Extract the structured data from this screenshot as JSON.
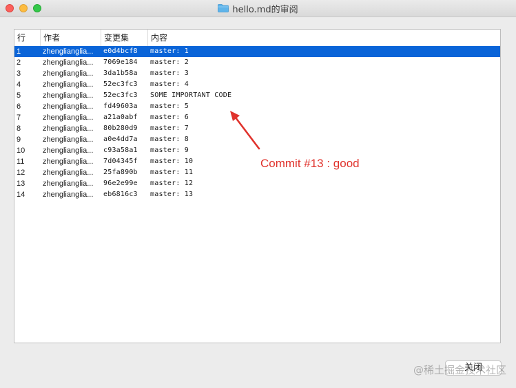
{
  "window": {
    "title": "hello.md的审阅"
  },
  "table": {
    "headers": {
      "line": "行",
      "author": "作者",
      "changeset": "变更集",
      "content": "内容"
    },
    "rows": [
      {
        "line": "1",
        "author": "zhenglianglia...",
        "changeset": "e0d4bcf8",
        "content": "master: 1",
        "selected": true
      },
      {
        "line": "2",
        "author": "zhenglianglia...",
        "changeset": "7069e184",
        "content": "master: 2"
      },
      {
        "line": "3",
        "author": "zhenglianglia...",
        "changeset": "3da1b58a",
        "content": "master: 3"
      },
      {
        "line": "4",
        "author": "zhenglianglia...",
        "changeset": "52ec3fc3",
        "content": "master: 4"
      },
      {
        "line": "5",
        "author": "zhenglianglia...",
        "changeset": "52ec3fc3",
        "content": "SOME IMPORTANT CODE"
      },
      {
        "line": "6",
        "author": "zhenglianglia...",
        "changeset": "fd49603a",
        "content": "master: 5"
      },
      {
        "line": "7",
        "author": "zhenglianglia...",
        "changeset": "a21a0abf",
        "content": "master: 6"
      },
      {
        "line": "8",
        "author": "zhenglianglia...",
        "changeset": "80b280d9",
        "content": "master: 7"
      },
      {
        "line": "9",
        "author": "zhenglianglia...",
        "changeset": "a0e4dd7a",
        "content": "master: 8"
      },
      {
        "line": "10",
        "author": "zhenglianglia...",
        "changeset": "c93a58a1",
        "content": "master: 9"
      },
      {
        "line": "11",
        "author": "zhenglianglia...",
        "changeset": "7d04345f",
        "content": "master: 10"
      },
      {
        "line": "12",
        "author": "zhenglianglia...",
        "changeset": "25fa890b",
        "content": "master: 11"
      },
      {
        "line": "13",
        "author": "zhenglianglia...",
        "changeset": "96e2e99e",
        "content": "master: 12"
      },
      {
        "line": "14",
        "author": "zhenglianglia...",
        "changeset": "eb6816c3",
        "content": "master: 13"
      }
    ]
  },
  "annotation": {
    "text": "Commit #13 : good",
    "color": "#e0322c"
  },
  "footer": {
    "close_label": "关闭"
  },
  "watermark": {
    "text": "@稀土掘金技术社区"
  },
  "colors": {
    "selection": "#0a64d8",
    "folder_icon": "#5fb4ea"
  }
}
